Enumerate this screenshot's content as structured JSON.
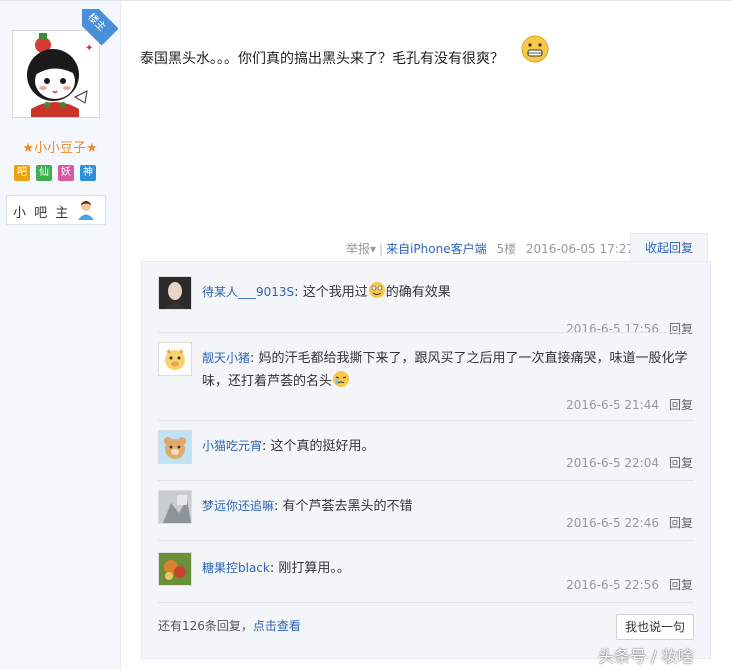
{
  "user": {
    "name": "★小小豆子★",
    "ribbon": "楼主",
    "badges": [
      {
        "text": "吧",
        "color": "#e8a30e"
      },
      {
        "text": "仙",
        "color": "#3cb04a"
      },
      {
        "text": "妖",
        "color": "#d45aa6"
      },
      {
        "text": "神",
        "color": "#2f8fd8"
      }
    ],
    "role": "小 吧 主"
  },
  "post": {
    "text": "泰国黑头水。。。你们真的搞出黑头来了？毛孔有没有很爽？",
    "report": "举报",
    "source": "来自iPhone客户端",
    "floor": "5楼",
    "time": "2016-06-05 17:27",
    "collapse": "收起回复"
  },
  "replies": [
    {
      "name": "待某人___9013S",
      "text_a": "这个我用过",
      "text_b": "的确有效果",
      "time": "2016-6-5 17:56",
      "reply": "回复"
    },
    {
      "name": "靓天小猪",
      "text_a": "妈的汗毛都给我撕下来了，跟风买了之后用了一次直接痛哭，味道一股化学味，还打着芦荟的名头",
      "text_b": "",
      "time": "2016-6-5 21:44",
      "reply": "回复"
    },
    {
      "name": "小猫吃元宵",
      "text_a": "这个真的挺好用。",
      "text_b": "",
      "time": "2016-6-5 22:04",
      "reply": "回复"
    },
    {
      "name": "梦远你还追嘛",
      "text_a": "有个芦荟去黑头的不错",
      "text_b": "",
      "time": "2016-6-5 22:46",
      "reply": "回复"
    },
    {
      "name": "糖果控black",
      "text_a": "刚打算用。。",
      "text_b": "",
      "time": "2016-6-5 22:56",
      "reply": "回复"
    }
  ],
  "footer": {
    "more_prefix": "还有126条回复，",
    "more_link": "点击查看",
    "say": "我也说一句"
  },
  "watermark": "头条号 / 妆啥"
}
